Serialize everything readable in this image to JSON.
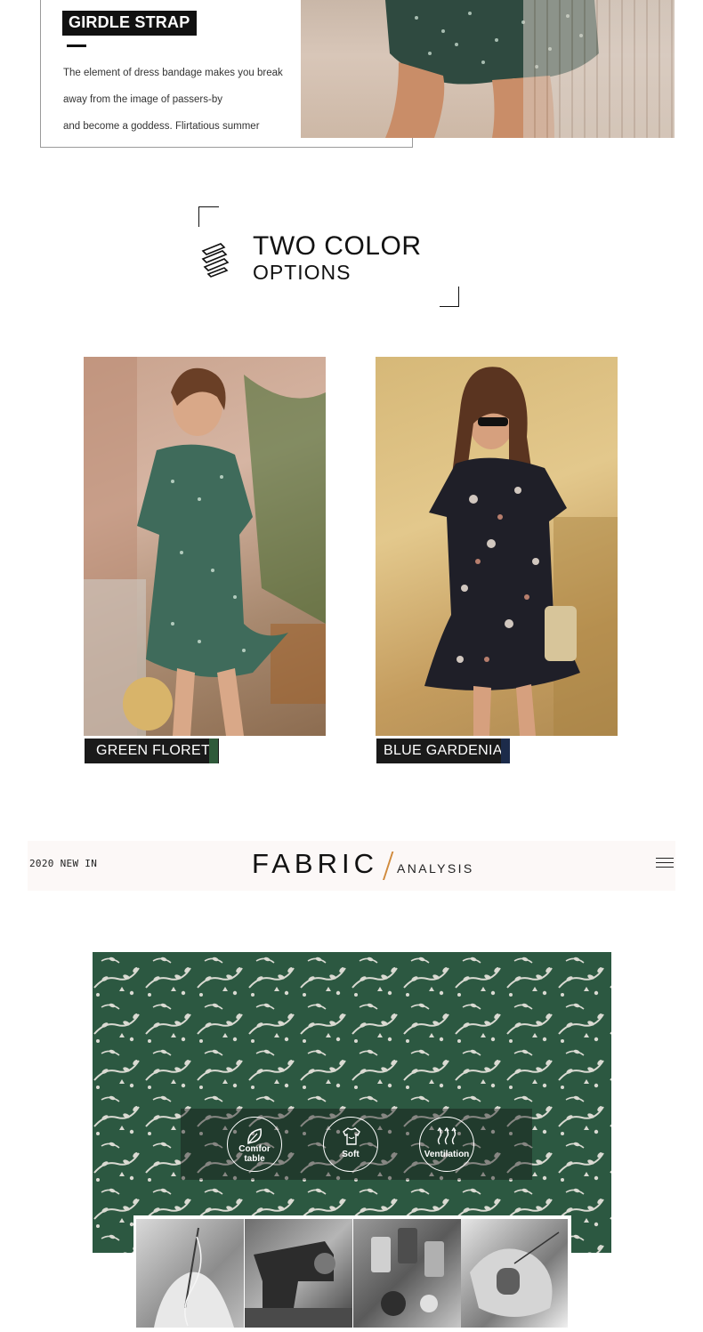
{
  "girdle": {
    "title": "GIRDLE STRAP",
    "lines": [
      "The element of dress bandage makes you break",
      "away from the image of passers-by",
      "and become a goddess. Flirtatious summer"
    ]
  },
  "two_color": {
    "title": "TWO COLOR",
    "subtitle": "OPTIONS"
  },
  "options": [
    {
      "label": "GREEN FLORET",
      "swatch": "#2f5a3a"
    },
    {
      "label": "BLUE GARDENIA",
      "swatch": "#1c2b4a"
    }
  ],
  "fabric_bar": {
    "left_text": "2020 NEW IN",
    "title": "FABRIC",
    "subtitle": "ANALYSIS",
    "accent": "#d08a3c"
  },
  "features": [
    {
      "icon": "leaf-icon",
      "label_1": "Comfor",
      "label_2": "table"
    },
    {
      "icon": "shirt-icon",
      "label_1": "Soft"
    },
    {
      "icon": "airflow-icon",
      "label_1": "Ventilation"
    }
  ],
  "colors": {
    "fabric_green": "#2e5d45",
    "label_bg": "#1a1a1a"
  }
}
